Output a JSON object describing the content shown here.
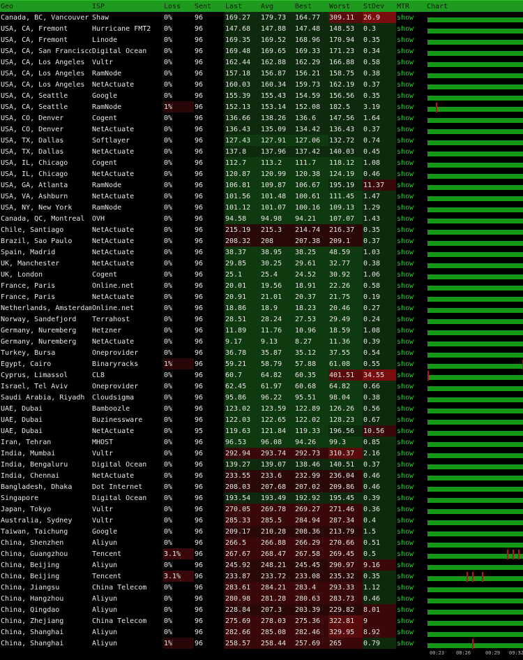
{
  "headers": [
    "Geo",
    "ISP",
    "Loss",
    "Sent",
    "Last",
    "Avg",
    "Best",
    "Worst",
    "StDev",
    "MTR",
    "Chart"
  ],
  "axis_ticks": [
    "00:23",
    "08:26",
    "00:29",
    "09:32"
  ],
  "colors": {
    "header": "#1e9a1e",
    "green": "#0f3f0f",
    "lightgreen": "#165a16",
    "red": "#3a0808",
    "darkred": "#5a0c0c",
    "brightred": "#8a1010",
    "link": "#2ecc2e"
  },
  "rows": [
    [
      "Canada, BC, Vancouver",
      "Shaw",
      "0%",
      "96",
      "169.27",
      "179.73",
      "164.77",
      "309.11",
      "26.9",
      "show"
    ],
    [
      "USA, CA, Fremont",
      "Hurricane FMT2",
      "0%",
      "96",
      "147.68",
      "147.88",
      "147.48",
      "148.53",
      "0.3",
      "show"
    ],
    [
      "USA, CA, Fremont",
      "Linode",
      "0%",
      "96",
      "169.35",
      "169.52",
      "168.96",
      "170.94",
      "0.35",
      "show"
    ],
    [
      "USA, CA, San Francisco",
      "Digital Ocean",
      "0%",
      "96",
      "169.48",
      "169.65",
      "169.33",
      "171.23",
      "0.34",
      "show"
    ],
    [
      "USA, CA, Los Angeles",
      "Vultr",
      "0%",
      "96",
      "162.44",
      "162.88",
      "162.29",
      "166.88",
      "0.58",
      "show"
    ],
    [
      "USA, CA, Los Angeles",
      "RamNode",
      "0%",
      "96",
      "157.18",
      "156.87",
      "156.21",
      "158.75",
      "0.38",
      "show"
    ],
    [
      "USA, CA, Los Angeles",
      "NetActuate",
      "0%",
      "96",
      "160.03",
      "160.34",
      "159.73",
      "162.19",
      "0.37",
      "show"
    ],
    [
      "USA, CA, Seattle",
      "Google",
      "0%",
      "96",
      "155.39",
      "155.43",
      "154.59",
      "156.56",
      "0.35",
      "show"
    ],
    [
      "USA, CA, Seattle",
      "RamNode",
      "1%",
      "96",
      "152.13",
      "153.14",
      "152.08",
      "182.5",
      "3.19",
      "show"
    ],
    [
      "USA, CO, Denver",
      "Cogent",
      "0%",
      "96",
      "136.66",
      "138.26",
      "136.6",
      "147.56",
      "1.64",
      "show"
    ],
    [
      "USA, CO, Denver",
      "NetActuate",
      "0%",
      "96",
      "136.43",
      "135.09",
      "134.42",
      "136.43",
      "0.37",
      "show"
    ],
    [
      "USA, TX, Dallas",
      "Softlayer",
      "0%",
      "96",
      "127.43",
      "127.91",
      "127.06",
      "132.72",
      "0.74",
      "show"
    ],
    [
      "USA, TX, Dallas",
      "NetActuate",
      "0%",
      "96",
      "137.8",
      "137.96",
      "137.42",
      "140.03",
      "0.45",
      "show"
    ],
    [
      "USA, IL, Chicago",
      "Cogent",
      "0%",
      "96",
      "112.7",
      "113.2",
      "111.7",
      "118.12",
      "1.08",
      "show"
    ],
    [
      "USA, IL, Chicago",
      "NetActuate",
      "0%",
      "96",
      "120.87",
      "120.99",
      "120.38",
      "124.19",
      "0.46",
      "show"
    ],
    [
      "USA, GA, Atlanta",
      "RamNode",
      "0%",
      "96",
      "106.81",
      "109.87",
      "106.67",
      "195.19",
      "11.37",
      "show"
    ],
    [
      "USA, VA, Ashburn",
      "NetActuate",
      "0%",
      "96",
      "101.56",
      "101.48",
      "100.61",
      "111.45",
      "1.47",
      "show"
    ],
    [
      "USA, NY, New York",
      "RamNode",
      "0%",
      "96",
      "101.12",
      "101.07",
      "100.16",
      "109.13",
      "1.29",
      "show"
    ],
    [
      "Canada, QC, Montreal",
      "OVH",
      "0%",
      "96",
      "94.58",
      "94.98",
      "94.21",
      "107.07",
      "1.43",
      "show"
    ],
    [
      "Chile, Santiago",
      "NetActuate",
      "0%",
      "96",
      "215.19",
      "215.3",
      "214.74",
      "216.37",
      "0.35",
      "show"
    ],
    [
      "Brazil, Sao Paulo",
      "NetActuate",
      "0%",
      "96",
      "208.32",
      "208",
      "207.38",
      "209.1",
      "0.37",
      "show"
    ],
    [
      "Spain, Madrid",
      "NetActuate",
      "0%",
      "96",
      "38.37",
      "38.95",
      "38.25",
      "48.59",
      "1.03",
      "show"
    ],
    [
      "UK, Manchester",
      "NetActuate",
      "0%",
      "96",
      "29.85",
      "30.25",
      "29.61",
      "32.77",
      "0.38",
      "show"
    ],
    [
      "UK, London",
      "Cogent",
      "0%",
      "96",
      "25.1",
      "25.4",
      "24.52",
      "30.92",
      "1.06",
      "show"
    ],
    [
      "France, Paris",
      "Online.net",
      "0%",
      "96",
      "20.01",
      "19.56",
      "18.91",
      "22.26",
      "0.58",
      "show"
    ],
    [
      "France, Paris",
      "NetActuate",
      "0%",
      "96",
      "20.91",
      "21.01",
      "20.37",
      "21.75",
      "0.19",
      "show"
    ],
    [
      "Netherlands, Amsterdam",
      "Online.net",
      "0%",
      "96",
      "18.86",
      "18.9",
      "18.23",
      "20.46",
      "0.27",
      "show"
    ],
    [
      "Norway, Sandefjord",
      "Terrahost",
      "0%",
      "96",
      "28.51",
      "28.24",
      "27.53",
      "29.49",
      "0.24",
      "show"
    ],
    [
      "Germany, Nuremberg",
      "Hetzner",
      "0%",
      "96",
      "11.89",
      "11.76",
      "10.96",
      "18.59",
      "1.08",
      "show"
    ],
    [
      "Germany, Nuremberg",
      "NetActuate",
      "0%",
      "96",
      "9.17",
      "9.13",
      "8.27",
      "11.36",
      "0.39",
      "show"
    ],
    [
      "Turkey, Bursa",
      "Oneprovider",
      "0%",
      "96",
      "36.78",
      "35.87",
      "35.12",
      "37.55",
      "0.54",
      "show"
    ],
    [
      "Egypt, Cairo",
      "Binaryracks",
      "1%",
      "96",
      "59.21",
      "58.79",
      "57.88",
      "61.08",
      "0.55",
      "show"
    ],
    [
      "Cyprus, Limassol",
      "CL8",
      "0%",
      "96",
      "60.7",
      "64.82",
      "60.35",
      "401.51",
      "34.55",
      "show"
    ],
    [
      "Israel, Tel Aviv",
      "Oneprovider",
      "0%",
      "96",
      "62.45",
      "61.97",
      "60.68",
      "64.82",
      "0.66",
      "show"
    ],
    [
      "Saudi Arabia, Riyadh",
      "Cloudsigma",
      "0%",
      "96",
      "95.86",
      "96.22",
      "95.51",
      "98.04",
      "0.38",
      "show"
    ],
    [
      "UAE, Dubai",
      "Bamboozle",
      "0%",
      "96",
      "123.02",
      "123.59",
      "122.89",
      "126.26",
      "0.56",
      "show"
    ],
    [
      "UAE, Dubai",
      "Buzinessware",
      "0%",
      "96",
      "122.03",
      "122.65",
      "122.02",
      "128.23",
      "0.67",
      "show"
    ],
    [
      "UAE, Dubai",
      "NetActuate",
      "0%",
      "95",
      "119.63",
      "121.84",
      "119.33",
      "196.56",
      "10.56",
      "show"
    ],
    [
      "Iran, Tehran",
      "MHOST",
      "0%",
      "96",
      "96.53",
      "96.08",
      "94.26",
      "99.3",
      "0.85",
      "show"
    ],
    [
      "India, Mumbai",
      "Vultr",
      "0%",
      "96",
      "292.94",
      "293.74",
      "292.73",
      "310.37",
      "2.16",
      "show"
    ],
    [
      "India, Bengaluru",
      "Digital Ocean",
      "0%",
      "96",
      "139.27",
      "139.07",
      "138.46",
      "140.51",
      "0.37",
      "show"
    ],
    [
      "India, Chennai",
      "NetActuate",
      "0%",
      "96",
      "233.55",
      "233.6",
      "232.99",
      "236.04",
      "0.46",
      "show"
    ],
    [
      "Bangladesh, Dhaka",
      "Dot Internet",
      "0%",
      "96",
      "208.03",
      "207.68",
      "207.02",
      "209.86",
      "0.46",
      "show"
    ],
    [
      "Singapore",
      "Digital Ocean",
      "0%",
      "96",
      "193.54",
      "193.49",
      "192.92",
      "195.45",
      "0.39",
      "show"
    ],
    [
      "Japan, Tokyo",
      "Vultr",
      "0%",
      "96",
      "270.05",
      "269.78",
      "269.27",
      "271.46",
      "0.36",
      "show"
    ],
    [
      "Australia, Sydney",
      "Vultr",
      "0%",
      "96",
      "285.33",
      "285.5",
      "284.94",
      "287.34",
      "0.4",
      "show"
    ],
    [
      "Taiwan, Taichung",
      "Google",
      "0%",
      "96",
      "209.17",
      "210.28",
      "208.36",
      "213.79",
      "1.5",
      "show"
    ],
    [
      "China, Shenzhen",
      "Aliyun",
      "0%",
      "96",
      "266.5",
      "266.88",
      "266.29",
      "270.66",
      "0.51",
      "show"
    ],
    [
      "China, Guangzhou",
      "Tencent",
      "3.1%",
      "96",
      "267.67",
      "268.47",
      "267.58",
      "269.45",
      "0.5",
      "show"
    ],
    [
      "China, Beijing",
      "Aliyun",
      "0%",
      "96",
      "245.92",
      "248.21",
      "245.45",
      "290.97",
      "9.16",
      "show"
    ],
    [
      "China, Beijing",
      "Tencent",
      "3.1%",
      "96",
      "233.87",
      "233.72",
      "233.08",
      "235.32",
      "0.35",
      "show"
    ],
    [
      "China, Jiangsu",
      "China Telecom",
      "0%",
      "96",
      "283.61",
      "284.21",
      "283.4",
      "293.33",
      "1.12",
      "show"
    ],
    [
      "China, Hangzhou",
      "Aliyun",
      "0%",
      "96",
      "280.98",
      "281.28",
      "280.63",
      "283.73",
      "0.46",
      "show"
    ],
    [
      "China, Qingdao",
      "Aliyun",
      "0%",
      "96",
      "228.84",
      "207.3",
      "203.39",
      "229.82",
      "8.01",
      "show"
    ],
    [
      "China, Zhejiang",
      "China Telecom",
      "0%",
      "96",
      "275.69",
      "278.03",
      "275.36",
      "322.81",
      "9",
      "show"
    ],
    [
      "China, Shanghai",
      "Aliyun",
      "0%",
      "96",
      "282.66",
      "285.08",
      "282.46",
      "329.95",
      "8.92",
      "show"
    ],
    [
      "China, Shanghai",
      "Aliyun",
      "1%",
      "96",
      "258.57",
      "258.44",
      "257.69",
      "265",
      "0.79",
      "show"
    ]
  ]
}
